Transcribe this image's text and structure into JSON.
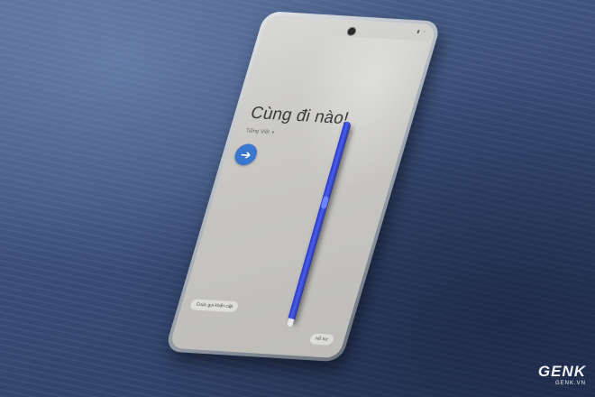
{
  "screen": {
    "title": "Cùng đi nào!",
    "language": "Tiếng Việt",
    "language_caret": "▾",
    "next_button_icon": "arrow-right-icon",
    "next_button_glyph": "➔",
    "emergency_call": "Cuộc gọi khẩn cấp",
    "support": "Hỗ trợ",
    "accent_color": "#3b76cf"
  },
  "watermark": {
    "brand": "GENK",
    "url": "GENK.VN"
  }
}
